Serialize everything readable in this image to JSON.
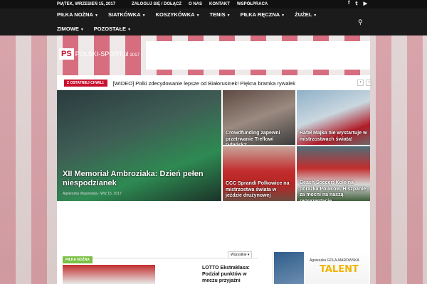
{
  "topbar": {
    "date": "PIĄTEK, WRZESIEŃ 15, 2017",
    "links": [
      "ZALOGUJ SIĘ / DOŁĄCZ",
      "O NAS",
      "KONTAKT",
      "WSPÓŁPRACA"
    ],
    "social": [
      "facebook-icon",
      "twitter-icon",
      "youtube-icon"
    ]
  },
  "nav": {
    "row1": [
      "PIŁKA NOŻNA",
      "SIATKÓWKA",
      "KOSZYKÓWKA",
      "TENIS",
      "PIŁKA RĘCZNA",
      "ŻUŻEL"
    ],
    "row2": [
      "ZIMOWE",
      "POZOSTAŁE"
    ]
  },
  "logo": {
    "ps": "PS",
    "name": "POLSKI-SPORT.pl",
    "year": "2017"
  },
  "ticker": {
    "badge": "Z OSTATNIEJ CHWILI:",
    "text": "[WIDEO] Polki zdecydowanie lepsze od Białorusinek! Piękna bramka rywalek"
  },
  "featured": {
    "big": {
      "title": "XII Memoriał Ambroziaka: Dzień pełen niespodzianek",
      "author": "Agnieszka Wąsowska",
      "date": "Wrz 15, 2017"
    },
    "tiles": [
      "Crowdfunding zapewni przetrwanie Treflowi Gdańsk?",
      "Rafał Majka nie wystartuje w mistrzostwach świata!",
      "CCC Sprandi Polkowice na mistrzostwa świata w jeździe drużynowej",
      "Beach Soccer: Kolejna porażka Polaków. Hiszpanie za mocni na naszą reprezentację…"
    ]
  },
  "section": {
    "badge": "PIŁKA NOŻNA",
    "filter": "Wszystkie",
    "news_title": "LOTTO Ekstraklasa: Podział punktów w meczu przyjaźni"
  },
  "ad": {
    "brand": "Agnieszka GOLA-MAROWSKA",
    "text": "TALENT"
  },
  "colors": {
    "accent": "#c8102e",
    "section": "#7ac143",
    "nav": "#1b1b1b"
  }
}
